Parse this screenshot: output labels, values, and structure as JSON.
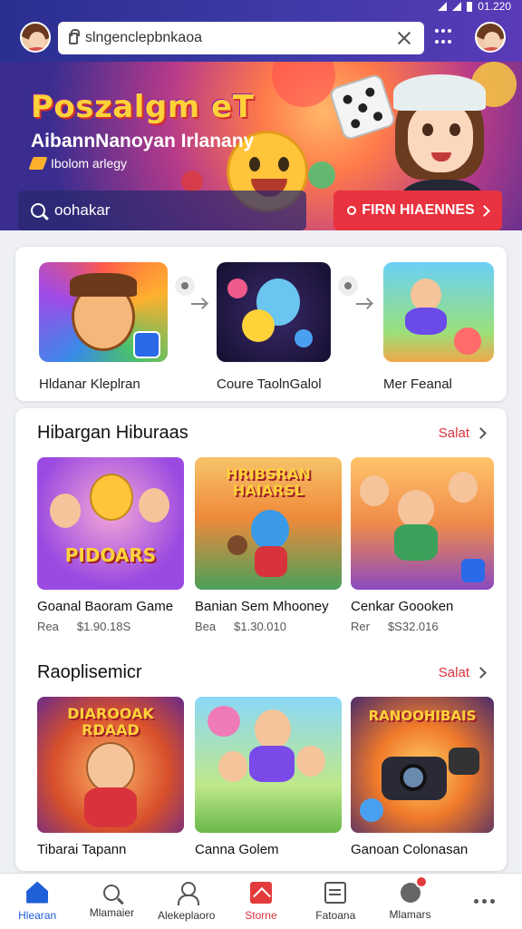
{
  "status": {
    "time": "01.220"
  },
  "topbar": {
    "url": "slngenclepbnkaoa"
  },
  "hero": {
    "title": "Poszalgm eT",
    "subtitle": "AibannNanoyan Irlanany",
    "tag": "Ibolom arlegy",
    "search_text": "oohakar",
    "cta_label": "FIRN HIAENNES"
  },
  "featured": [
    {
      "label": "Hldanar Kleplran"
    },
    {
      "label": "Coure TaolnGalol"
    },
    {
      "label": "Mer Feanal"
    }
  ],
  "sections": [
    {
      "title": "Hibargan Hiburaas",
      "see_all": "Salat",
      "games": [
        {
          "name": "Goanal  Baoram Game",
          "meta_label": "Rea",
          "price": "$1.90.18S",
          "art_text": "PIDOARS"
        },
        {
          "name": "Banian Sem Mhooney",
          "meta_label": "Bea",
          "price": "$1.30.010",
          "art_text": "HRIBSRAN HAIARSL"
        },
        {
          "name": "Cenkar Goooken",
          "meta_label": "Rer",
          "price": "$S32.016",
          "art_text": ""
        }
      ]
    },
    {
      "title": "Raoplisemicr",
      "see_all": "Salat",
      "games": [
        {
          "name": "Tibarai Tapann",
          "art_text": "DIAROOAK RDAAD"
        },
        {
          "name": "Canna Golem",
          "art_text": ""
        },
        {
          "name": "Ganoan Colonasan",
          "art_text": "RANOOHIBAIS"
        }
      ]
    }
  ],
  "nav": [
    {
      "label": "Hlearan",
      "icon": "home-icon"
    },
    {
      "label": "Mlamaier",
      "icon": "search-icon"
    },
    {
      "label": "Alekeplaoro",
      "icon": "person-icon"
    },
    {
      "label": "Storne",
      "icon": "store-icon"
    },
    {
      "label": "Fatoana",
      "icon": "box-icon"
    },
    {
      "label": "Mlamars",
      "icon": "chat-icon"
    },
    {
      "label": "",
      "icon": "more-icon"
    }
  ],
  "colors": {
    "accent": "#1f5fd8",
    "brand_red": "#d9323c",
    "header": "#2a2f8f"
  }
}
